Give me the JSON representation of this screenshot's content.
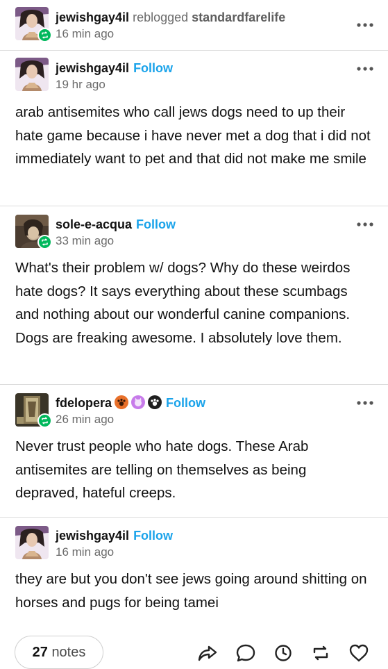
{
  "header": {
    "username": "jewishgay4il",
    "reblogged_label": "reblogged",
    "source": "standardfarelife",
    "time": "16 min ago"
  },
  "posts": [
    {
      "username": "jewishgay4il",
      "follow_label": "Follow",
      "time": "19 hr ago",
      "text": "arab antisemites who call jews dogs need to up their hate game because i have never met a dog that i did not immediately want to pet and that did not make me smile"
    },
    {
      "username": "sole-e-acqua",
      "follow_label": "Follow",
      "time": "33 min ago",
      "text": "What's their problem w/ dogs? Why do these weirdos hate dogs? It says everything about these scumbags and nothing about our wonderful canine companions. Dogs are freaking awesome. I absolutely love them."
    },
    {
      "username": "fdelopera",
      "follow_label": "Follow",
      "time": "26 min ago",
      "text": "Never trust people who hate dogs. These Arab antisemites are telling on themselves as being depraved, hateful creeps."
    },
    {
      "username": "jewishgay4il",
      "follow_label": "Follow",
      "time": "16 min ago",
      "text": "they are but you don't see jews going around shitting on horses and pugs for being tamei"
    }
  ],
  "footer": {
    "notes_count": "27",
    "notes_label": "notes",
    "icons": [
      "share-icon",
      "reply-icon",
      "schedule-icon",
      "reblog-icon",
      "like-icon"
    ]
  },
  "colors": {
    "follow": "#1aa3ea",
    "reblog_badge": "#00b85c",
    "muted_text": "#6b6b6b"
  }
}
